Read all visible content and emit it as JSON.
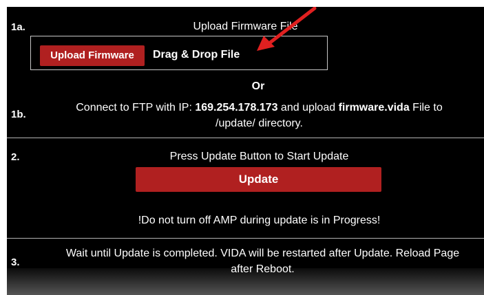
{
  "step1a": {
    "number": "1a.",
    "title": "Upload Firmware File",
    "upload_button": "Upload Firmware",
    "drop_label": "Drag & Drop File"
  },
  "or_label": "Or",
  "step1b": {
    "number": "1b.",
    "text_before_ip": "Connect to FTP with IP: ",
    "ip": "169.254.178.173",
    "text_mid": " and upload ",
    "filename": "firmware.vida",
    "text_after": " File to",
    "line2": "/update/ directory."
  },
  "step2": {
    "number": "2.",
    "instruction": "Press Update Button to Start Update",
    "update_button": "Update",
    "warning": "!Do not turn off AMP during update is in Progress!"
  },
  "step3": {
    "number": "3.",
    "line1": "Wait until Update is completed. VIDA will be restarted after Update. Reload Page",
    "line2": "after Reboot."
  },
  "colors": {
    "background": "#000000",
    "button_red": "#b02020",
    "annotation_arrow": "#e02020"
  },
  "icons": {
    "annotation": "red-arrow-icon"
  }
}
